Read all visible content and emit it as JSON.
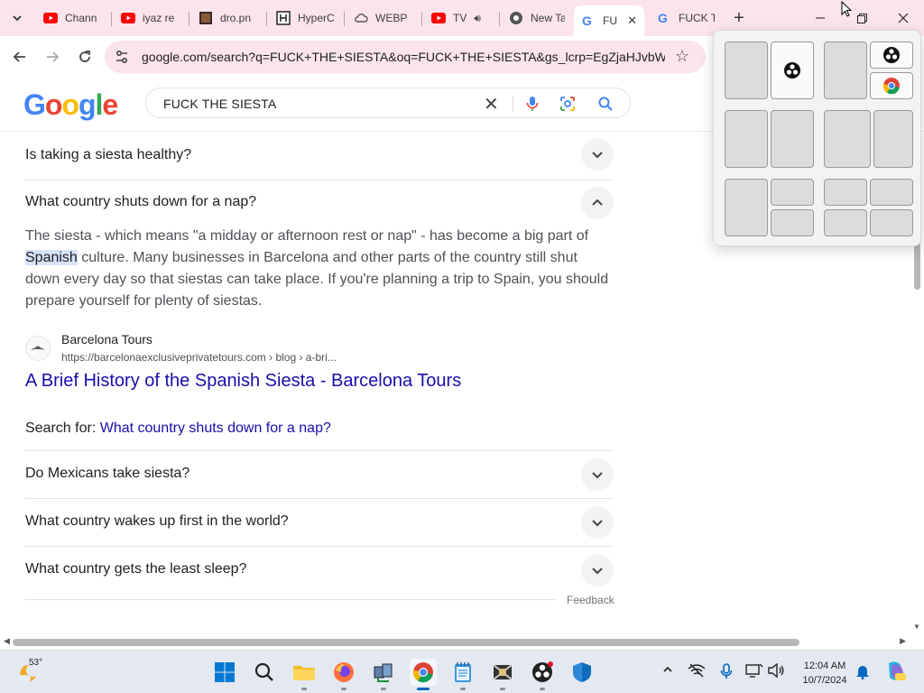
{
  "tabs": [
    {
      "title": "Chann",
      "favicon": "youtube-icon"
    },
    {
      "title": "iyaz re",
      "favicon": "youtube-icon"
    },
    {
      "title": "dro.pn",
      "favicon": "image-file-icon"
    },
    {
      "title": "HyperC",
      "favicon": "hyper-icon"
    },
    {
      "title": "WEBP",
      "favicon": "cloud-icon"
    },
    {
      "title": "TV",
      "favicon": "youtube-icon"
    },
    {
      "title": "New Ta",
      "favicon": "chrome-icon"
    },
    {
      "title": "FU",
      "favicon": "google-icon",
      "active": true
    },
    {
      "title": "FUCK T",
      "favicon": "google-icon"
    }
  ],
  "toolbar": {
    "url": "google.com/search?q=FUCK+THE+SIESTA&oq=FUCK+THE+SIESTA&gs_lcrp=EgZjaHJvbWU..."
  },
  "search": {
    "logo": "Google",
    "query": "FUCK THE SIESTA"
  },
  "results": {
    "questions_above": [
      "Is taking a siesta healthy?",
      "What country shuts down for a nap?"
    ],
    "answer": {
      "before_highlight": "The siesta - which means \"a midday or afternoon rest or nap\" - has become a big part of",
      "highlight": "Spanish",
      "after_highlight": "culture. Many businesses in Barcelona and other parts of the country still shut down every day so that siestas can take place. If you're planning a trip to Spain, you should prepare yourself for plenty of siestas."
    },
    "source": {
      "name": "Barcelona Tours",
      "url": "https://barcelonaexclusiveprivatetours.com › blog › a-bri...",
      "title": "A Brief History of the Spanish Siesta - Barcelona Tours"
    },
    "search_for_label": "Search for:",
    "search_for_link": "What country shuts down for a nap?",
    "questions_below": [
      "Do Mexicans take siesta?",
      "What country wakes up first in the world?",
      "What country gets the least sleep?"
    ],
    "feedback": "Feedback"
  },
  "taskbar": {
    "temperature": "53°",
    "time": "12:04 AM",
    "date": "10/7/2024"
  },
  "colors": {
    "tabstrip_bg": "#fbe4ec",
    "link": "#1a0dab",
    "taskbar_bg": "#e4e9f1"
  }
}
